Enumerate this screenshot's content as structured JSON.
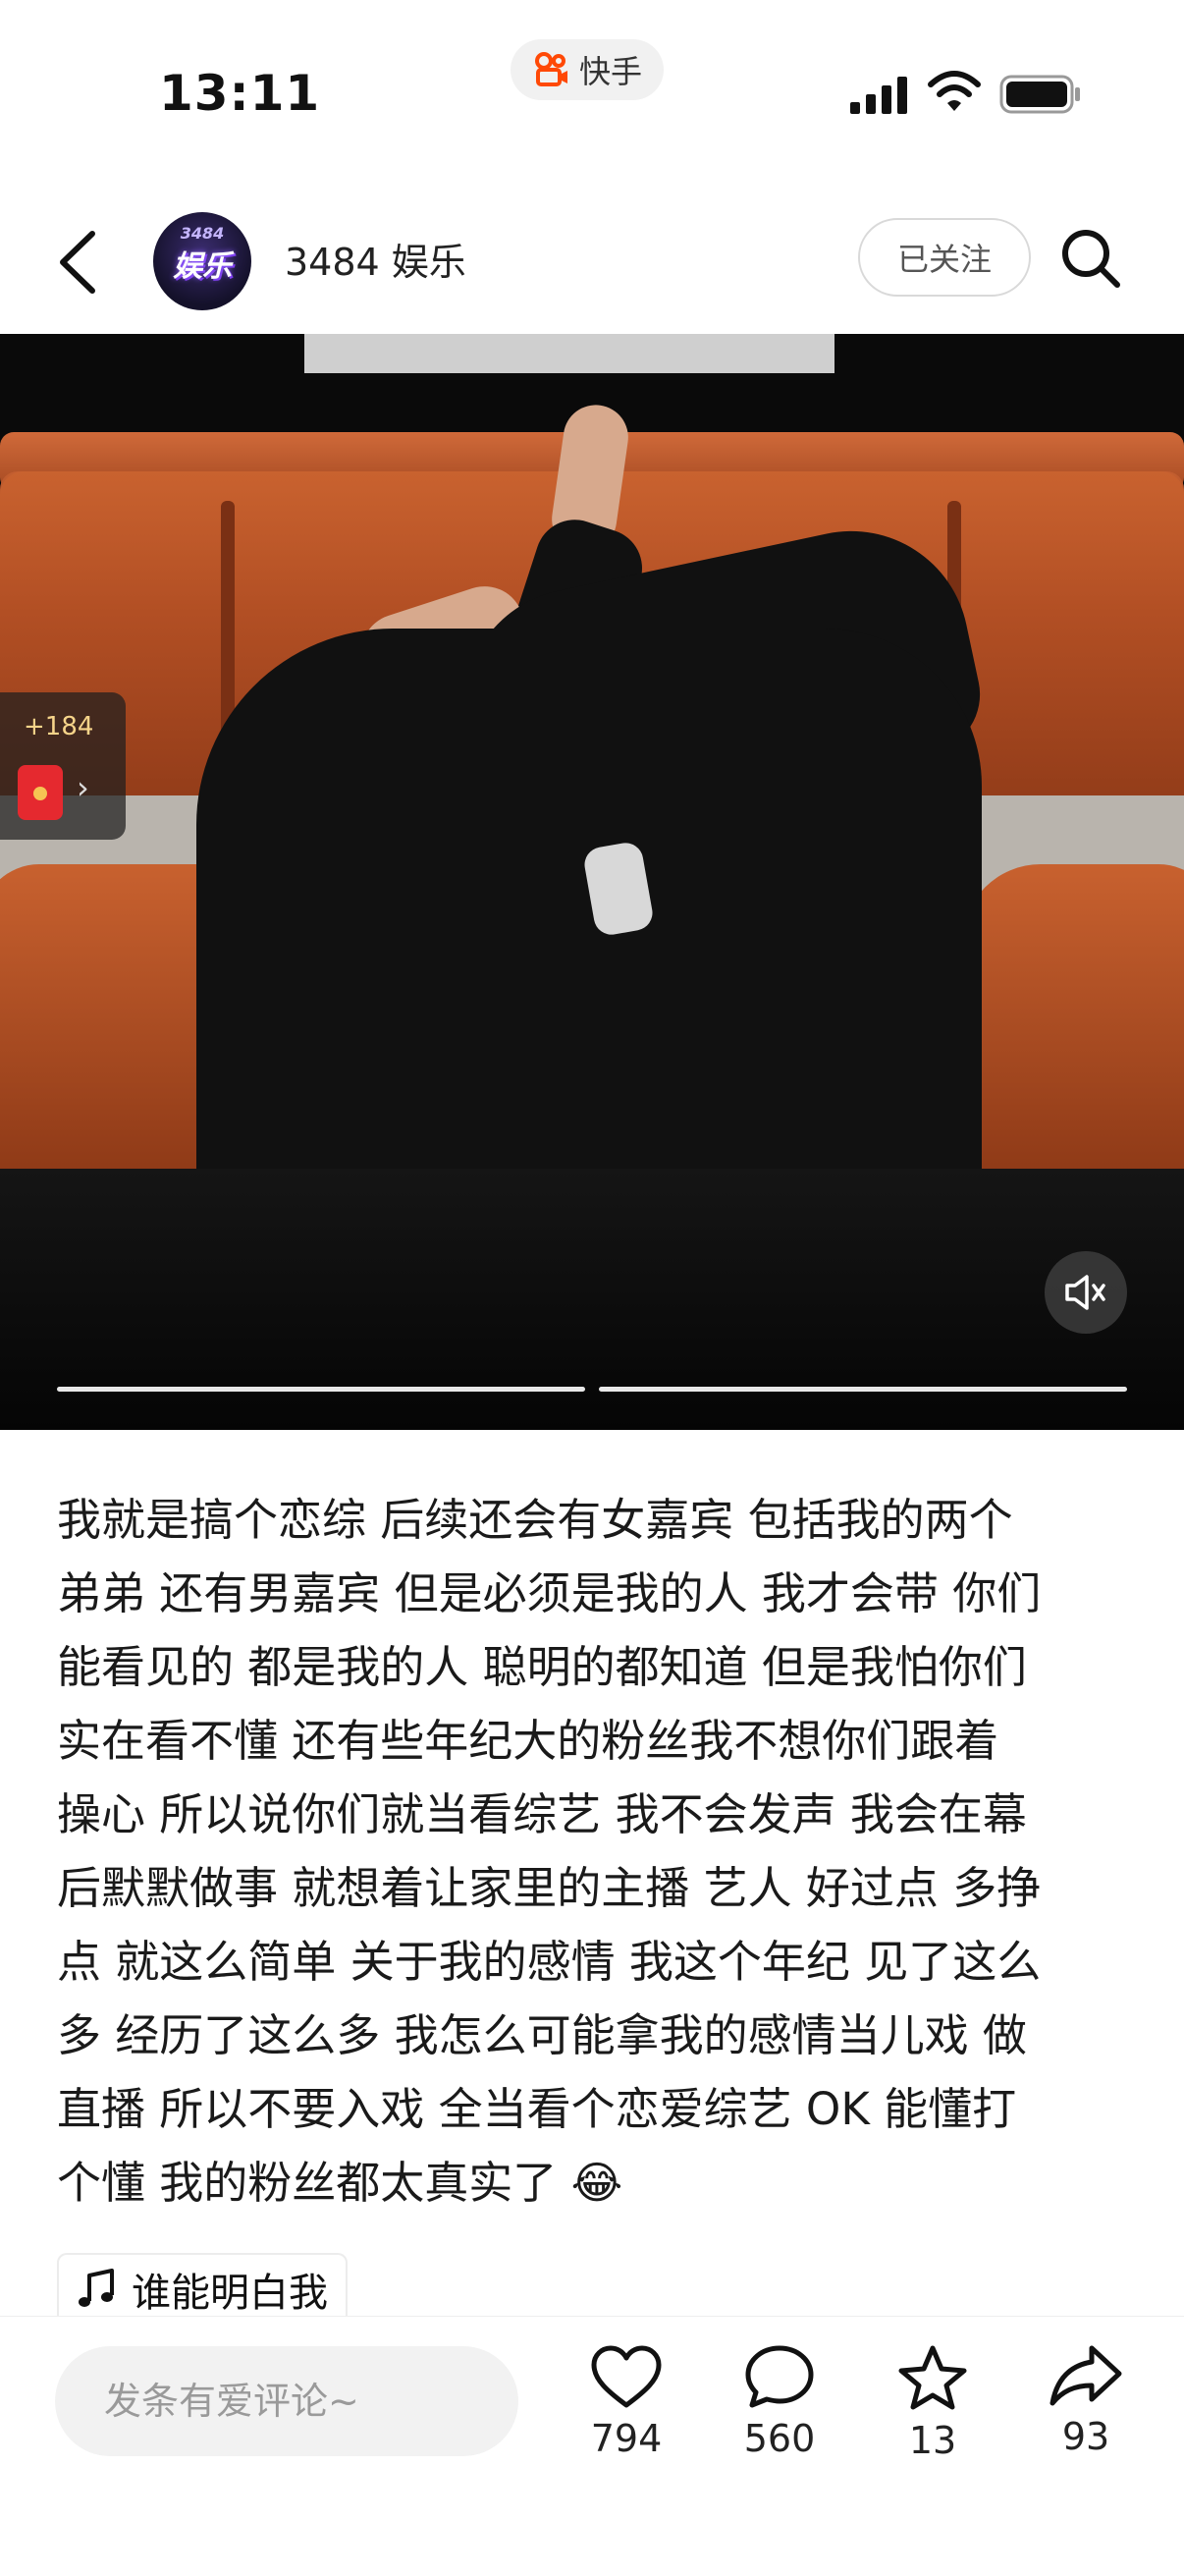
{
  "status_bar": {
    "time": "13:11",
    "app_badge": "快手"
  },
  "header": {
    "account_name": "3484 娱乐",
    "avatar_text": "娱乐",
    "avatar_num": "3484",
    "follow_label": "已关注"
  },
  "media": {
    "reward_count": "+184",
    "progress_segments": 2
  },
  "post": {
    "caption_lines": [
      "我就是搞个恋综 后续还会有女嘉宾 包括我的两个",
      "弟弟 还有男嘉宾 但是必须是我的人 我才会带 你们",
      "能看见的 都是我的人 聪明的都知道 但是我怕你们",
      "实在看不懂 还有些年纪大的粉丝我不想你们跟着",
      "操心 所以说你们就当看综艺 我不会发声 我会在幕",
      "后默默做事 就想着让家里的主播 艺人 好过点 多挣",
      "点 就这么简单 关于我的感情 我这个年纪 见了这么",
      "多 经历了这么多 我怎么可能拿我的感情当儿戏 做",
      "直播 所以不要入戏 全当看个恋爱综艺 OK 能懂打",
      "个懂 我的粉丝都太真实了 😂"
    ],
    "music_title": "谁能明白我"
  },
  "bottom_bar": {
    "comment_placeholder": "发条有爱评论~",
    "likes": "794",
    "comments": "560",
    "favorites": "13",
    "shares": "93"
  },
  "icons": {
    "back": "back-arrow-icon",
    "search": "search-icon",
    "sound": "speaker-icon",
    "music": "music-note-icon",
    "like": "heart-icon",
    "comment": "comment-bubble-icon",
    "favorite": "star-icon",
    "share": "share-arrow-icon"
  }
}
